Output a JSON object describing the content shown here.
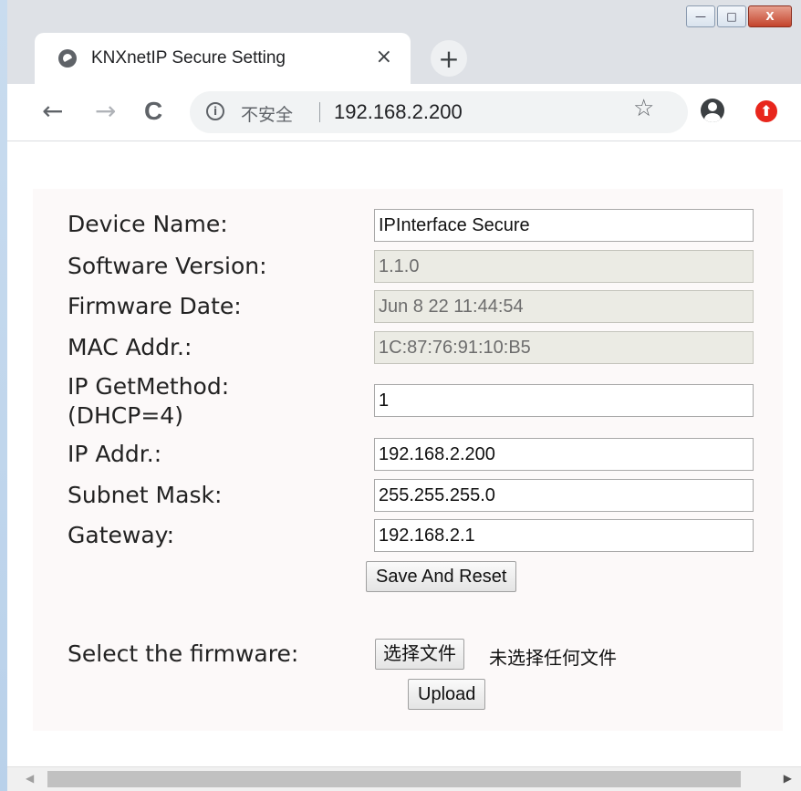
{
  "browser": {
    "tab_title": "KNXnetIP Secure Setting",
    "tab_close": "×",
    "new_tab": "+",
    "nav": {
      "back": "←",
      "forward": "→",
      "reload": "C"
    },
    "omnibox": {
      "security_label": "不安全",
      "url": "192.168.2.200"
    },
    "window_controls": {
      "minimize": "—",
      "maximize": "□",
      "close": "X"
    }
  },
  "form": {
    "fields": [
      {
        "label": "Device Name:",
        "value": "IPInterface Secure",
        "readonly": false
      },
      {
        "label": "Software Version:",
        "value": "1.1.0",
        "readonly": true
      },
      {
        "label": "Firmware Date:",
        "value": "Jun  8 22 11:44:54",
        "readonly": true
      },
      {
        "label": "MAC Addr.:",
        "value": "1C:87:76:91:10:B5",
        "readonly": true
      },
      {
        "label_line1": "IP GetMethod:",
        "label_line2": "(DHCP=4)",
        "value": "1",
        "readonly": false
      },
      {
        "label": "IP Addr.:",
        "value": "192.168.2.200",
        "readonly": false
      },
      {
        "label": "Subnet Mask:",
        "value": "255.255.255.0",
        "readonly": false
      },
      {
        "label": "Gateway:",
        "value": "192.168.2.1",
        "readonly": false
      }
    ],
    "save_button": "Save And Reset"
  },
  "firmware": {
    "label": "Select the firmware:",
    "choose_button": "选择文件",
    "file_status": "未选择任何文件",
    "upload_button": "Upload"
  },
  "colors": {
    "panel_bg": "#fcf9f9",
    "readonly_bg": "#ebebe4",
    "extension_icon": "#e8261c"
  }
}
